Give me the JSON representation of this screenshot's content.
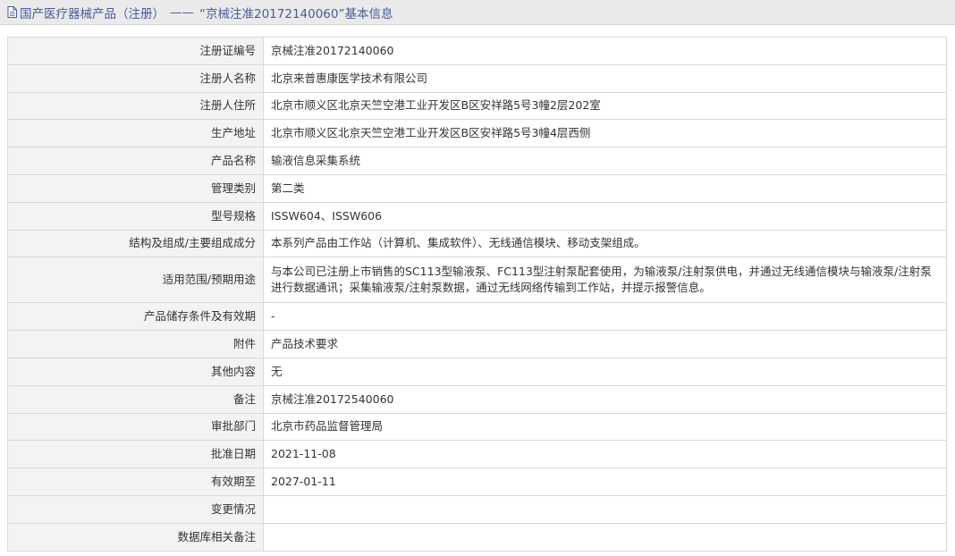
{
  "header": {
    "icon": "document-icon",
    "category": "国产医疗器械产品（注册）",
    "separator": "——",
    "title": "“京械注准20172140060”基本信息"
  },
  "rows": [
    {
      "label": "注册证编号",
      "value": "京械注准20172140060"
    },
    {
      "label": "注册人名称",
      "value": "北京来普惠康医学技术有限公司"
    },
    {
      "label": "注册人住所",
      "value": "北京市顺义区北京天竺空港工业开发区B区安祥路5号3幢2层202室"
    },
    {
      "label": "生产地址",
      "value": "北京市顺义区北京天竺空港工业开发区B区安祥路5号3幢4层西侧"
    },
    {
      "label": "产品名称",
      "value": "输液信息采集系统"
    },
    {
      "label": "管理类别",
      "value": "第二类"
    },
    {
      "label": "型号规格",
      "value": "ISSW604、ISSW606"
    },
    {
      "label": "结构及组成/主要组成成分",
      "value": "本系列产品由工作站（计算机、集成软件）、无线通信模块、移动支架组成。"
    },
    {
      "label": "适用范围/预期用途",
      "value": "与本公司已注册上市销售的SC113型输液泵、FC113型注射泵配套使用，为输液泵/注射泵供电，并通过无线通信模块与输液泵/注射泵进行数据通讯；采集输液泵/注射泵数据，通过无线网络传输到工作站，并提示报警信息。"
    },
    {
      "label": "产品储存条件及有效期",
      "value": "-"
    },
    {
      "label": "附件",
      "value": "产品技术要求"
    },
    {
      "label": "其他内容",
      "value": "无"
    },
    {
      "label": "备注",
      "value": "京械注准20172540060"
    },
    {
      "label": "审批部门",
      "value": "北京市药品监督管理局"
    },
    {
      "label": "批准日期",
      "value": "2021-11-08"
    },
    {
      "label": "有效期至",
      "value": "2027-01-11"
    },
    {
      "label": "变更情况",
      "value": ""
    },
    {
      "label": "数据库相关备注",
      "value": ""
    }
  ]
}
